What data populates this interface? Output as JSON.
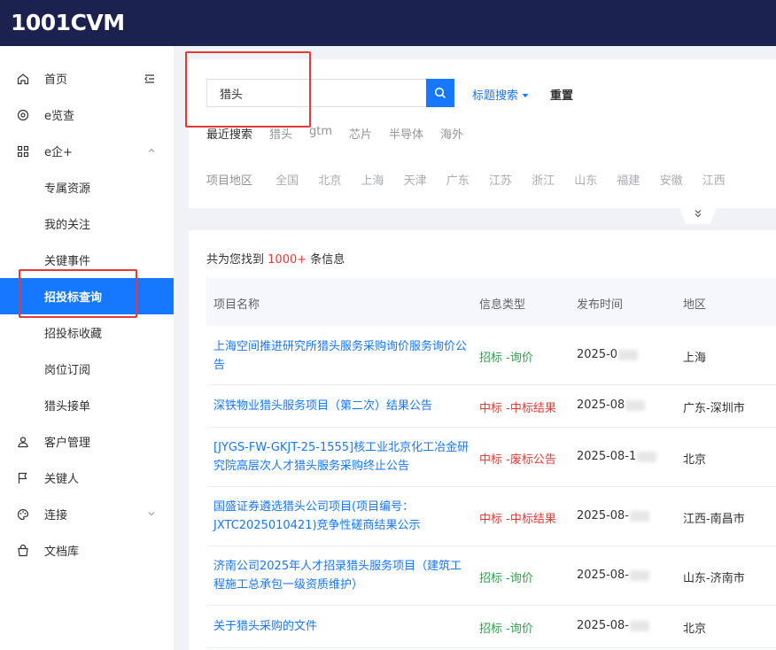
{
  "brand": {
    "logo_text": "1001CVM"
  },
  "sidebar": {
    "items": [
      {
        "label": "首页",
        "icon": "home-icon"
      },
      {
        "label": "e览查",
        "icon": "at-icon"
      },
      {
        "label": "e企+",
        "icon": "grid-icon"
      },
      {
        "label": "专属资源"
      },
      {
        "label": "我的关注"
      },
      {
        "label": "关键事件"
      },
      {
        "label": "招投标查询",
        "active": true
      },
      {
        "label": "招投标收藏"
      },
      {
        "label": "岗位订阅"
      },
      {
        "label": "猎头接单"
      },
      {
        "label": "客户管理",
        "icon": "user-icon"
      },
      {
        "label": "关键人",
        "icon": "flag-icon"
      },
      {
        "label": "连接",
        "icon": "palette-icon"
      },
      {
        "label": "文档库",
        "icon": "bag-icon"
      }
    ]
  },
  "search": {
    "value": "猎头",
    "title_search_label": "标题搜索",
    "reset_label": "重置",
    "recent_label": "最近搜索",
    "recent_items": [
      "猎头",
      "gtm",
      "芯片",
      "半导体",
      "海外"
    ],
    "region_label": "项目地区",
    "regions": [
      "全国",
      "北京",
      "上海",
      "天津",
      "广东",
      "江苏",
      "浙江",
      "山东",
      "福建",
      "安徽",
      "江西"
    ]
  },
  "results": {
    "count_prefix": "共为您找到",
    "count_value": "1000+",
    "count_suffix": "条信息",
    "columns": [
      "项目名称",
      "信息类型",
      "发布时间",
      "地区"
    ],
    "rows": [
      {
        "name": "上海空间推进研究所猎头服务采购询价服务询价公告",
        "type": "招标 -询价",
        "date": "2025-0",
        "region": "上海"
      },
      {
        "name": "深铁物业猎头服务项目（第二次）结果公告",
        "type": "中标 -中标结果",
        "date": "2025-08",
        "region": "广东-深圳市"
      },
      {
        "name": "[JYGS-FW-GKJT-25-1555]核工业北京化工冶金研究院高层次人才猎头服务采购终止公告",
        "type": "中标 -废标公告",
        "date": "2025-08-1",
        "region": "北京"
      },
      {
        "name": "国盛证券遴选猎头公司项目(项目编号：JXTC2025010421)竞争性磋商结果公示",
        "type": "中标 -中标结果",
        "date": "2025-08-",
        "region": "江西-南昌市"
      },
      {
        "name": "济南公司2025年人才招录猎头服务项目（建筑工程施工总承包一级资质维护）",
        "type": "招标 -询价",
        "date": "2025-08-",
        "region": "山东-济南市"
      },
      {
        "name": "关于猎头采购的文件",
        "type": "招标 -询价",
        "date": "2025-08-",
        "region": "北京"
      }
    ]
  },
  "colors": {
    "accent": "#1677ff",
    "header_bg": "#1c2250",
    "highlight": "#e53935",
    "bid_green": "#2e9e4c",
    "award_red": "#e53935"
  }
}
